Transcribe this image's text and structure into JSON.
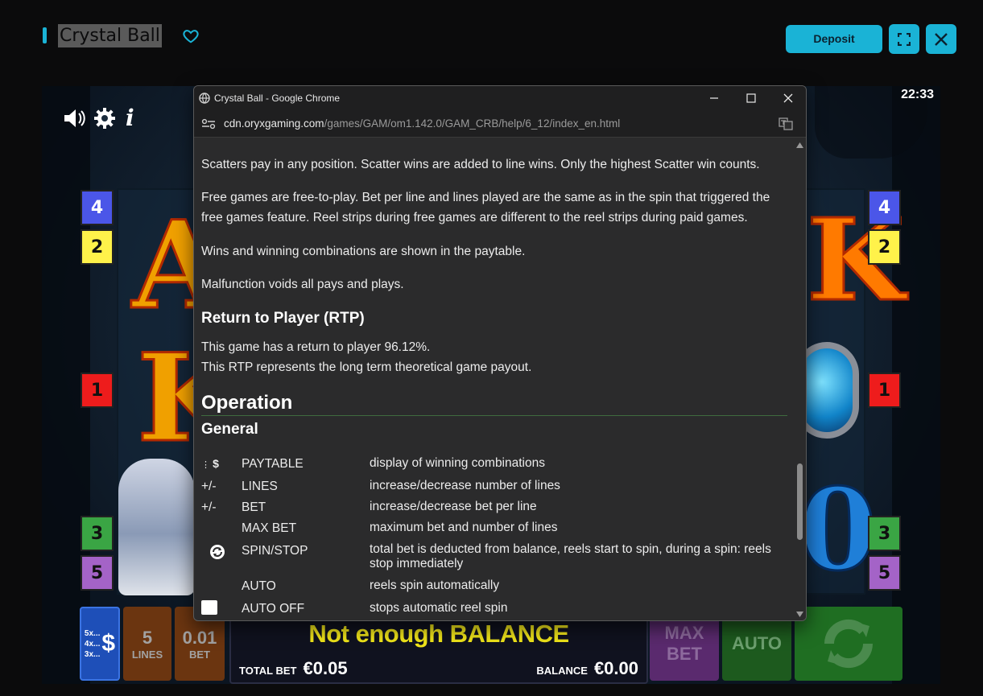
{
  "header": {
    "game_title": "Crystal Ball",
    "deposit_label": "Deposit",
    "fullscreen_icon": "expand-icon",
    "close_icon": "close-icon",
    "favorite_icon": "heart-icon"
  },
  "game": {
    "clock": "22:33",
    "left_markers": [
      "4",
      "2",
      "1",
      "3",
      "5"
    ],
    "right_markers": [
      "4",
      "2",
      "1",
      "3",
      "5"
    ],
    "controls": {
      "paytable_lines": [
        "5x...",
        "4x...",
        "3x..."
      ],
      "paytable_symbol": "$",
      "lines_value": "5",
      "lines_label": "LINES",
      "bet_value": "0.01",
      "bet_label": "BET",
      "message": "Not enough BALANCE",
      "total_bet_label": "TOTAL BET",
      "total_bet_value": "€0.05",
      "balance_label": "BALANCE",
      "balance_value": "€0.00",
      "max_bet_label_1": "MAX",
      "max_bet_label_2": "BET",
      "auto_label": "AUTO"
    }
  },
  "popup": {
    "window_title": "Crystal Ball - Google Chrome",
    "url_host": "cdn.oryxgaming.com",
    "url_path": "/games/GAM/om1.142.0/GAM_CRB/help/6_12/index_en.html",
    "paragraphs": {
      "scatters": "Scatters pay in any position. Scatter wins are added to line wins. Only the highest Scatter win counts.",
      "free_games": "Free games are free-to-play. Bet per line and lines played are the same as in the spin that triggered the free games feature. Reel strips during free games are different to the reel strips during paid games.",
      "wins": "Wins and winning combinations are shown in the paytable.",
      "malfunction": "Malfunction voids all pays and plays."
    },
    "rtp_heading": "Return to Player (RTP)",
    "rtp_line1": "This game has a return to player 96.12%.",
    "rtp_line2": "This RTP represents the long term theoretical game payout.",
    "operation_heading": "Operation",
    "general_heading": "General",
    "operations": [
      {
        "icon": "",
        "name": "PAYTABLE",
        "desc": "display of winning combinations"
      },
      {
        "icon": "+/-",
        "name": "LINES",
        "desc": "increase/decrease number of lines"
      },
      {
        "icon": "+/-",
        "name": "BET",
        "desc": "increase/decrease bet per line"
      },
      {
        "icon": "",
        "name": "MAX BET",
        "desc": "maximum bet and number of lines"
      },
      {
        "icon": "",
        "name": "SPIN/STOP",
        "desc": "total bet is deducted from balance, reels start to spin, during a spin: reels stop immediately"
      },
      {
        "icon": "",
        "name": "AUTO",
        "desc": "reels spin automatically"
      },
      {
        "icon": "",
        "name": "AUTO OFF",
        "desc": "stops automatic reel spin"
      }
    ]
  }
}
